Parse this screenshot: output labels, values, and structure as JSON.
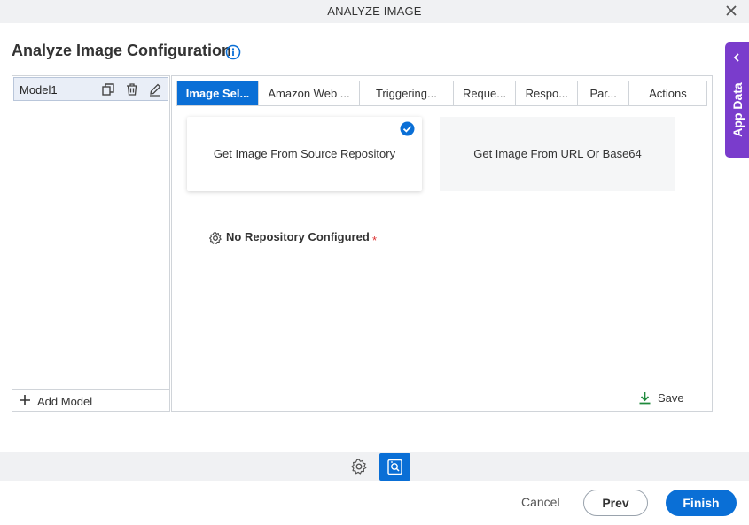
{
  "window": {
    "title": "ANALYZE IMAGE",
    "close_icon": "close-icon"
  },
  "page": {
    "title": "Analyze Image Configuration",
    "info_icon": "info-icon"
  },
  "app_data_tab": {
    "label": "App Data",
    "icon": "chevron-left-icon",
    "color": "#7a3ccc"
  },
  "models": {
    "items": [
      {
        "label": "Model1"
      }
    ],
    "item_icons": [
      "copy-icon",
      "delete-icon",
      "edit-icon"
    ],
    "add_label": "Add Model"
  },
  "tabs": [
    {
      "label": "Image Sel...",
      "active": true
    },
    {
      "label": "Amazon Web ...",
      "active": false
    },
    {
      "label": "Triggering...",
      "active": false
    },
    {
      "label": "Reque...",
      "active": false
    },
    {
      "label": "Respo...",
      "active": false
    },
    {
      "label": "Par...",
      "active": false
    },
    {
      "label": "Actions",
      "active": false
    }
  ],
  "image_source": {
    "options": [
      {
        "label": "Get Image From Source Repository",
        "selected": true
      },
      {
        "label": "Get Image From URL Or Base64",
        "selected": false
      }
    ]
  },
  "repository": {
    "label": "No Repository Configured",
    "required_mark": "*"
  },
  "save": {
    "label": "Save"
  },
  "footer": {
    "cancel_label": "Cancel",
    "prev_label": "Prev",
    "finish_label": "Finish"
  },
  "colors": {
    "accent": "#0a6fd6",
    "purple": "#7a3ccc",
    "save_icon": "#1f8a3c"
  }
}
